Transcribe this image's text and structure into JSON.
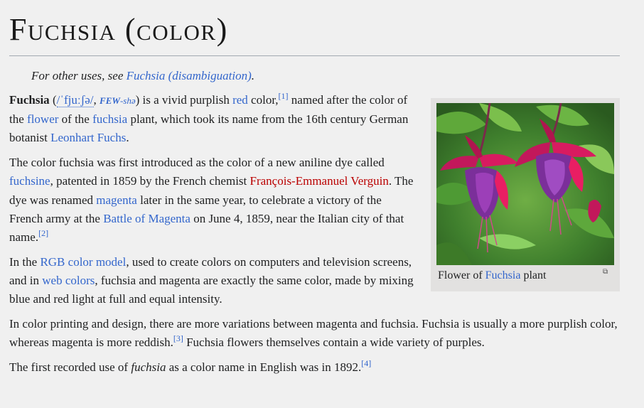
{
  "title": "Fuchsia (color)",
  "hatnote": {
    "prefix": "For other uses, see ",
    "link": "Fuchsia (disambiguation)",
    "suffix": "."
  },
  "infobox": {
    "caption_prefix": "Flower of ",
    "caption_link": "Fuchsia",
    "caption_suffix": " plant",
    "enlarge_icon": "magnify-clip-icon",
    "photo_colors": {
      "leaf": "#4e9a34",
      "petal": "#c2185b",
      "corolla": "#7b2f9a"
    }
  },
  "paragraphs": {
    "p1": {
      "bold": "Fuchsia",
      "t1": " (",
      "ipa": "/ˈfjuːʃə/",
      "t2": ", ",
      "resp_bold": "FEW",
      "resp_rest": "-shə",
      "t3": ") is a vivid purplish ",
      "link_red": "red",
      "t4": " color,",
      "ref1": "[1]",
      "t5": " named after the color of the ",
      "link_flower": "flower",
      "t6": " of the ",
      "link_fuchsia": "fuchsia",
      "t7": " plant, which took its name from the 16th century German botanist ",
      "link_fuchs": "Leonhart Fuchs",
      "t8": "."
    },
    "p2": {
      "t1": "The color fuchsia was first introduced as the color of a new aniline dye called ",
      "link_fuchsine": "fuchsine",
      "t2": ", patented in 1859 by the French chemist ",
      "link_verguin": "François-Emmanuel Verguin",
      "t3": ". The dye was renamed ",
      "link_magenta": "magenta",
      "t4": " later in the same year, to celebrate a victory of the French army at the ",
      "link_battle": "Battle of Magenta",
      "t5": " on June 4, 1859, near the Italian city of that name.",
      "ref2": "[2]"
    },
    "p3": {
      "t1": "In the ",
      "link_rgb": "RGB color model",
      "t2": ", used to create colors on computers and television screens, and in ",
      "link_web": "web colors",
      "t3": ", fuchsia and magenta are exactly the same color, made by mixing blue and red light at full and equal intensity."
    },
    "p4": {
      "t1": "In color printing and design, there are more variations between magenta and fuchsia. Fuchsia is usually a more purplish color, whereas magenta is more reddish.",
      "ref3": "[3]",
      "t2": " Fuchsia flowers themselves contain a wide variety of purples."
    },
    "p5": {
      "t1": "The first recorded use of ",
      "italic": "fuchsia",
      "t2": " as a color name in English was in 1892.",
      "ref4": "[4]"
    }
  }
}
